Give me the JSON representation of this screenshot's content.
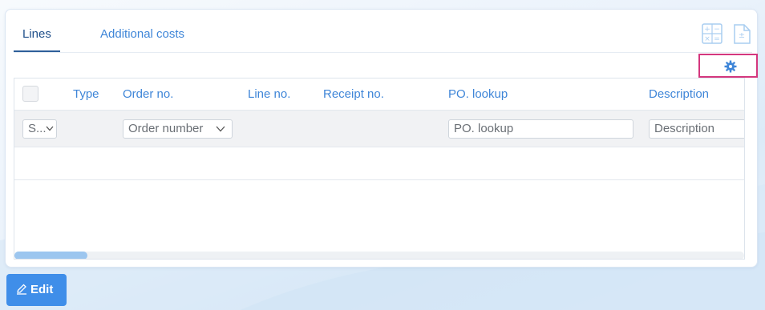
{
  "tabs": [
    {
      "label": "Lines"
    },
    {
      "label": "Additional costs"
    }
  ],
  "toolbar": {
    "calculator_icon": "calculator-icon",
    "document_icon": "document-plus-minus-icon",
    "settings_icon": "gear-icon"
  },
  "grid": {
    "columns": [
      "Type",
      "Order no.",
      "Line no.",
      "Receipt no.",
      "PO. lookup",
      "Description"
    ],
    "filters": {
      "select_value": "S...",
      "order_placeholder": "Order number",
      "po_lookup_placeholder": "PO. lookup",
      "description_placeholder": "Description"
    },
    "horizontal_scroll_fraction": 0.1
  },
  "actions": {
    "edit_label": "Edit"
  },
  "colors": {
    "accent": "#3f86d8",
    "highlight_border": "#d4377e",
    "edit_button": "#3f8ee9"
  }
}
